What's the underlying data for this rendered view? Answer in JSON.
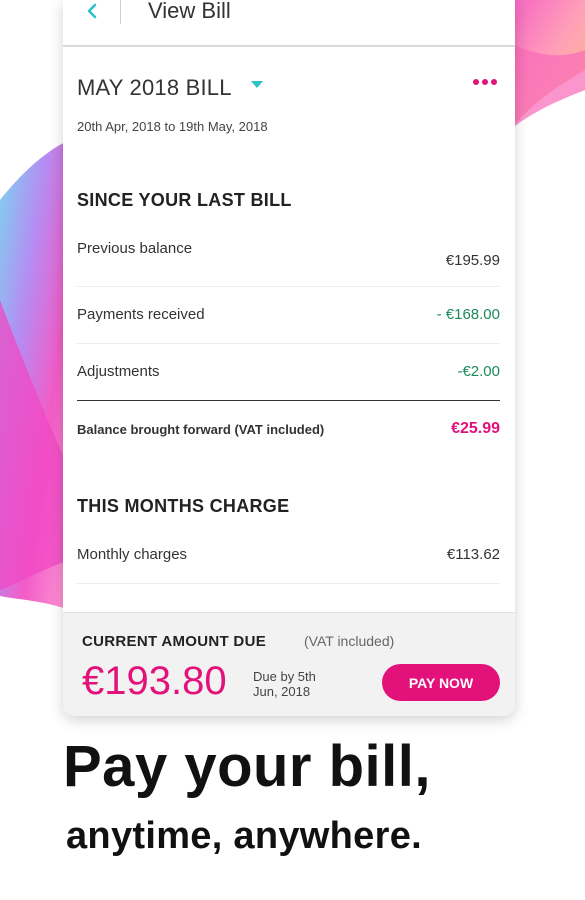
{
  "header": {
    "title": "View Bill"
  },
  "bill": {
    "title": "MAY 2018 BILL",
    "period": "20th Apr, 2018 to 19th May, 2018"
  },
  "since_last_bill": {
    "title": "SINCE YOUR LAST BILL",
    "rows": [
      {
        "label": "Previous balance",
        "value": "€195.99"
      },
      {
        "label": "Payments received",
        "value": "- €168.00"
      },
      {
        "label": "Adjustments",
        "value": "-€2.00"
      }
    ],
    "balance": {
      "label": "Balance brought forward (VAT included)",
      "value": "€25.99"
    }
  },
  "this_month": {
    "title": "THIS MONTHS CHARGE",
    "rows": [
      {
        "label": "Monthly charges",
        "value": "€113.62"
      }
    ]
  },
  "amount_due": {
    "label": "CURRENT AMOUNT DUE",
    "vat_note": "(VAT included)",
    "amount": "€193.80",
    "due_date": "Due by 5th Jun, 2018",
    "pay_button": "PAY NOW"
  },
  "promo": {
    "headline": "Pay your bill,",
    "subline": "anytime, anywhere."
  },
  "colors": {
    "accent": "#e2127a",
    "teal": "#29c3c9",
    "credit": "#1a8a5a"
  },
  "icons": {
    "back": "chevron-left-icon",
    "dropdown": "caret-down-icon",
    "menu": "more-dots-icon"
  }
}
